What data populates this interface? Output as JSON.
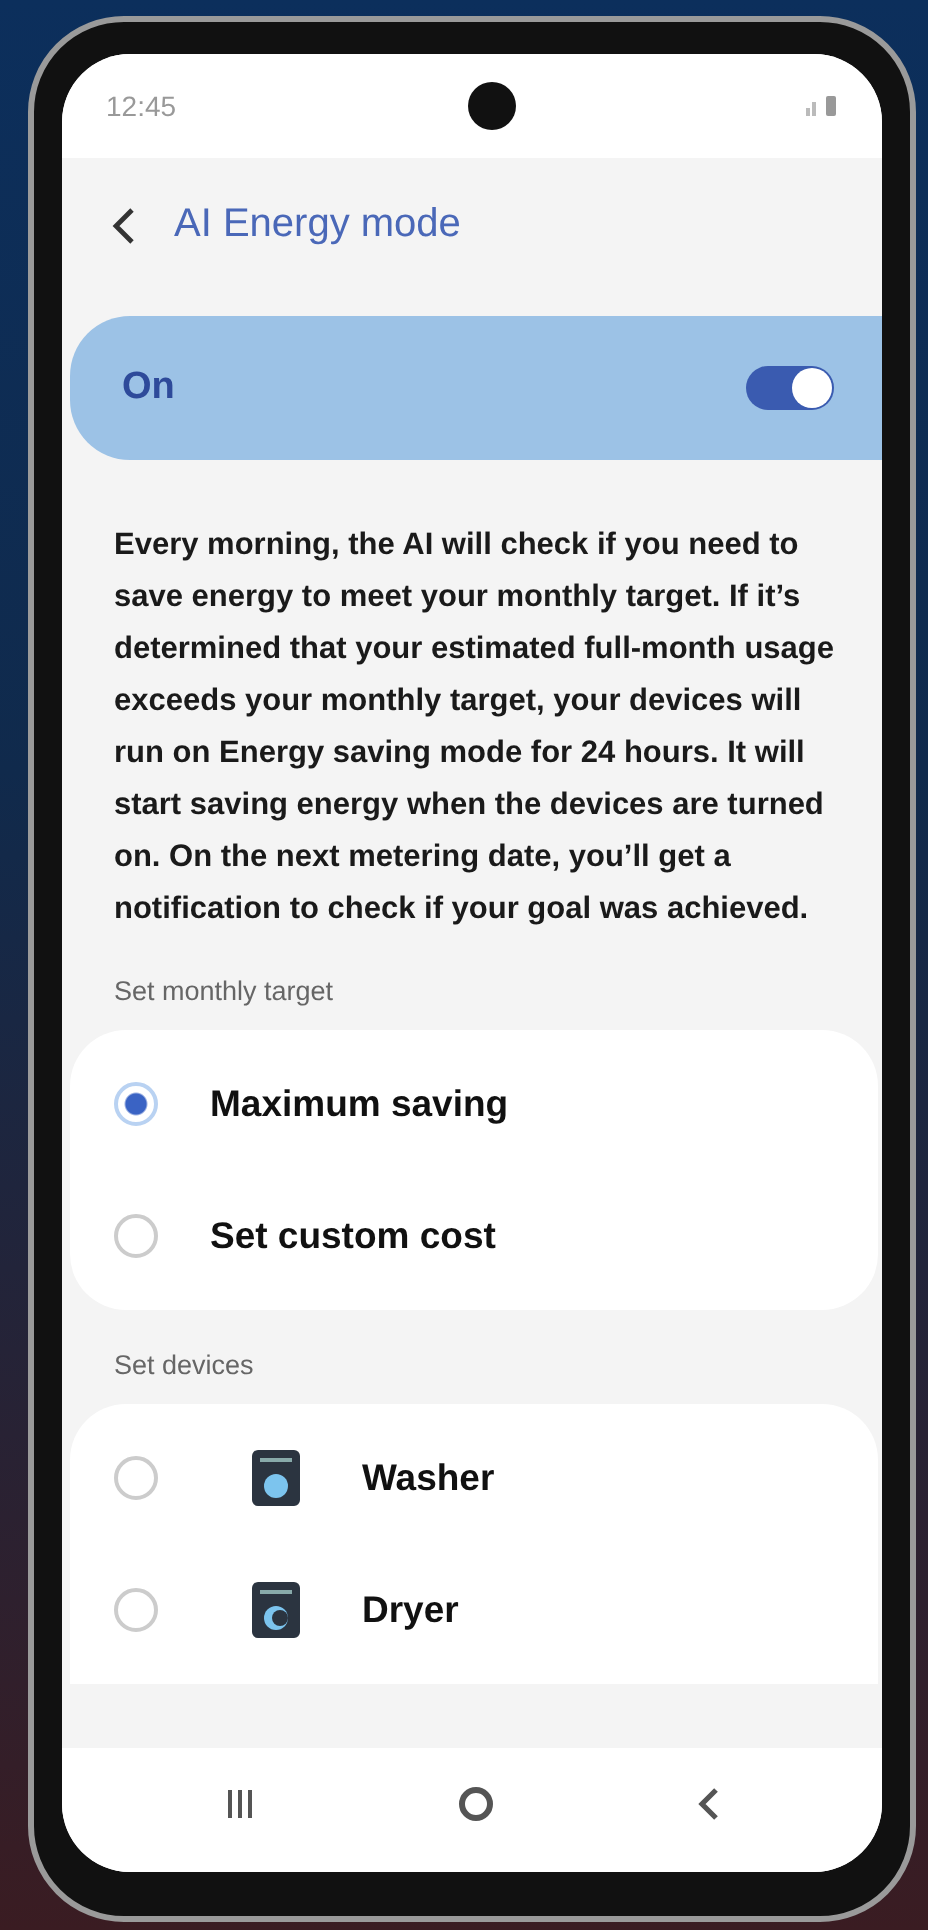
{
  "status_bar": {
    "time": "12:45"
  },
  "header": {
    "title": "AI Energy mode"
  },
  "master_switch": {
    "label": "On",
    "on": true
  },
  "description": "Every morning, the AI will check if you need to save energy to meet your monthly target. If it’s determined that your estimated full-month usage exceeds your monthly target, your devices will run on Energy saving mode for 24 hours. It will start saving energy when the devices are turned on. On the next metering date, you’ll get a notification to check if your goal was achieved.",
  "target_section": {
    "title": "Set monthly target",
    "options": [
      {
        "label": "Maximum saving",
        "selected": true
      },
      {
        "label": "Set custom cost",
        "selected": false
      }
    ]
  },
  "devices_section": {
    "title": "Set devices",
    "devices": [
      {
        "label": "Washer",
        "kind": "washer",
        "selected": false
      },
      {
        "label": "Dryer",
        "kind": "dryer",
        "selected": false
      }
    ]
  }
}
